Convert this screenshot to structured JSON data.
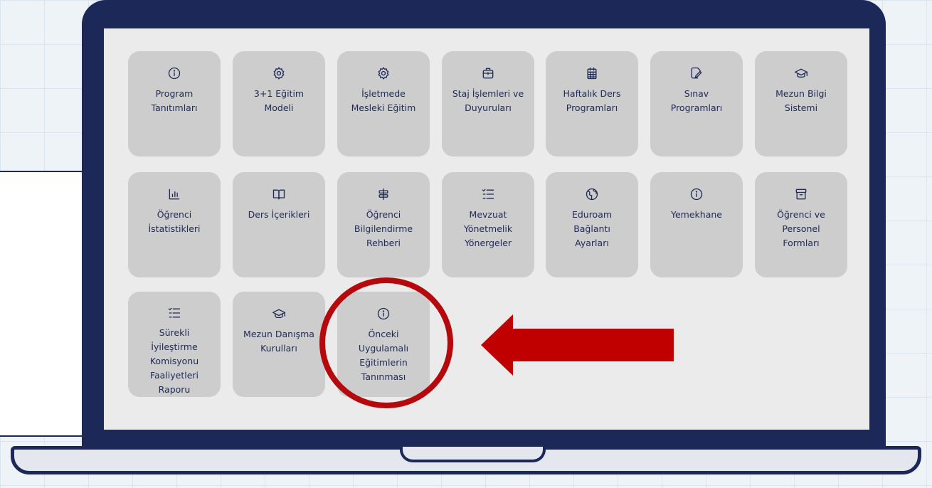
{
  "screen": {
    "tiles": [
      {
        "label": "Program\nTanıtımları",
        "icon": "info-circle-icon"
      },
      {
        "label": "3+1 Eğitim\nModeli",
        "icon": "gear-icon"
      },
      {
        "label": "İşletmede\nMesleki Eğitim",
        "icon": "gear-icon"
      },
      {
        "label": "Staj İşlemleri ve\nDuyuruları",
        "icon": "briefcase-icon"
      },
      {
        "label": "Haftalık Ders\nProgramları",
        "icon": "calendar-icon"
      },
      {
        "label": "Sınav\nProgramları",
        "icon": "document-edit-icon"
      },
      {
        "label": "Mezun Bilgi\nSistemi",
        "icon": "graduation-cap-icon"
      },
      {
        "label": "Öğrenci\nİstatistikleri",
        "icon": "bar-chart-icon"
      },
      {
        "label": "Ders İçerikleri",
        "icon": "book-icon"
      },
      {
        "label": "Öğrenci\nBilgilendirme\nRehberi",
        "icon": "signpost-icon"
      },
      {
        "label": "Mevzuat\nYönetmelik\nYönergeler",
        "icon": "checklist-icon"
      },
      {
        "label": "Eduroam\nBağlantı\nAyarları",
        "icon": "globe-icon"
      },
      {
        "label": "Yemekhane",
        "icon": "info-circle-icon"
      },
      {
        "label": "Öğrenci ve\nPersonel\nFormları",
        "icon": "archive-icon"
      },
      {
        "label": "Sürekli\nİyileştirme\nKomisyonu\nFaaliyetleri\nRaporu",
        "icon": "checklist-icon"
      },
      {
        "label": "Mezun Danışma\nKurulları",
        "icon": "graduation-cap-icon"
      },
      {
        "label": "Önceki\nUygulamalı\nEğitimlerin\nTanınması",
        "icon": "info-circle-icon"
      }
    ]
  },
  "annotation": {
    "highlight_color": "#b5090d",
    "arrow_color": "#c00000",
    "highlighted_tile": "Önceki Uygulamalı Eğitimlerin Tanınması"
  }
}
